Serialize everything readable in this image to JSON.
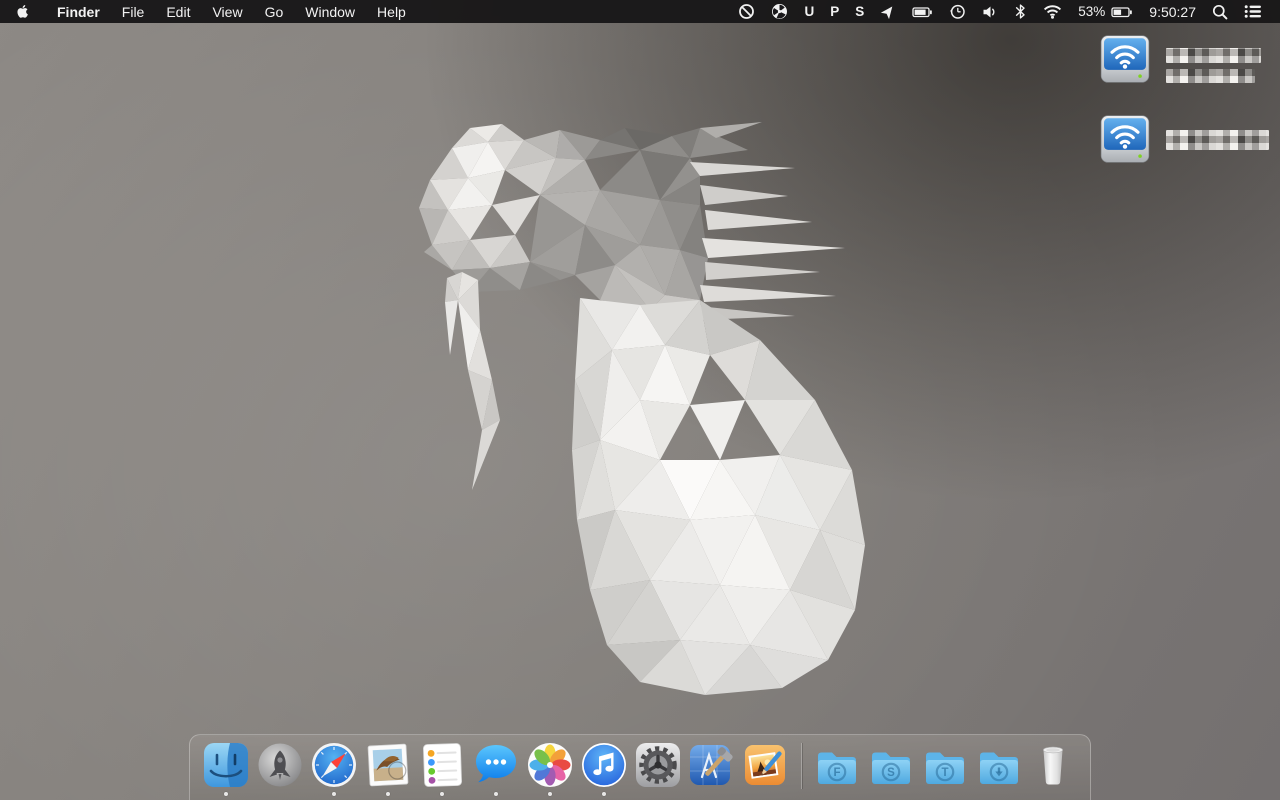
{
  "menu_bar": {
    "apple_icon": "apple-logo",
    "menus": [
      {
        "label": "Finder",
        "bold": true
      },
      {
        "label": "File"
      },
      {
        "label": "Edit"
      },
      {
        "label": "View"
      },
      {
        "label": "Go"
      },
      {
        "label": "Window"
      },
      {
        "label": "Help"
      }
    ],
    "status": {
      "u_label": "U",
      "p_label": "P",
      "s_label": "S",
      "battery_percent": "53%",
      "clock": "9:50:27"
    },
    "status_icon_names": [
      "prohibitory-icon",
      "fan-icon",
      "letter-u",
      "letter-p",
      "letter-s",
      "location-arrow-icon",
      "device-battery-icon",
      "time-machine-icon",
      "volume-icon",
      "bluetooth-icon",
      "wifi-icon",
      "battery-icon",
      "spotlight-search-icon",
      "notification-center-icon"
    ]
  },
  "desktop": {
    "wallpaper": {
      "description": "Low-poly faceted white rabbit sculpture on warm gray gradient background"
    },
    "drives": [
      {
        "icon": "wireless-network-drive-icon",
        "label_obscured": true,
        "label_lines": 2
      },
      {
        "icon": "wireless-network-drive-icon",
        "label_obscured": true,
        "label_lines": 1
      }
    ]
  },
  "dock": {
    "apps": [
      {
        "name": "finder",
        "running": true
      },
      {
        "name": "launchpad",
        "running": false
      },
      {
        "name": "safari",
        "running": true
      },
      {
        "name": "mail",
        "running": true
      },
      {
        "name": "reminders",
        "running": true
      },
      {
        "name": "messages",
        "running": true
      },
      {
        "name": "photos",
        "running": true
      },
      {
        "name": "itunes",
        "running": true
      },
      {
        "name": "system-preferences",
        "running": false
      },
      {
        "name": "xcode",
        "running": false
      },
      {
        "name": "photo-editor",
        "running": false
      }
    ],
    "folders": [
      {
        "glyph": "F"
      },
      {
        "glyph": "S"
      },
      {
        "glyph": "T"
      },
      {
        "glyph": "download-arrow"
      }
    ],
    "trash": "trash"
  },
  "colors": {
    "menu_bar_bg": "#19181a",
    "folder_blue": "#5db4e8",
    "drive_blue": "#2f7cd0",
    "wallpaper_center": "#8d8985",
    "wallpaper_dark_corner": "#49453f"
  }
}
